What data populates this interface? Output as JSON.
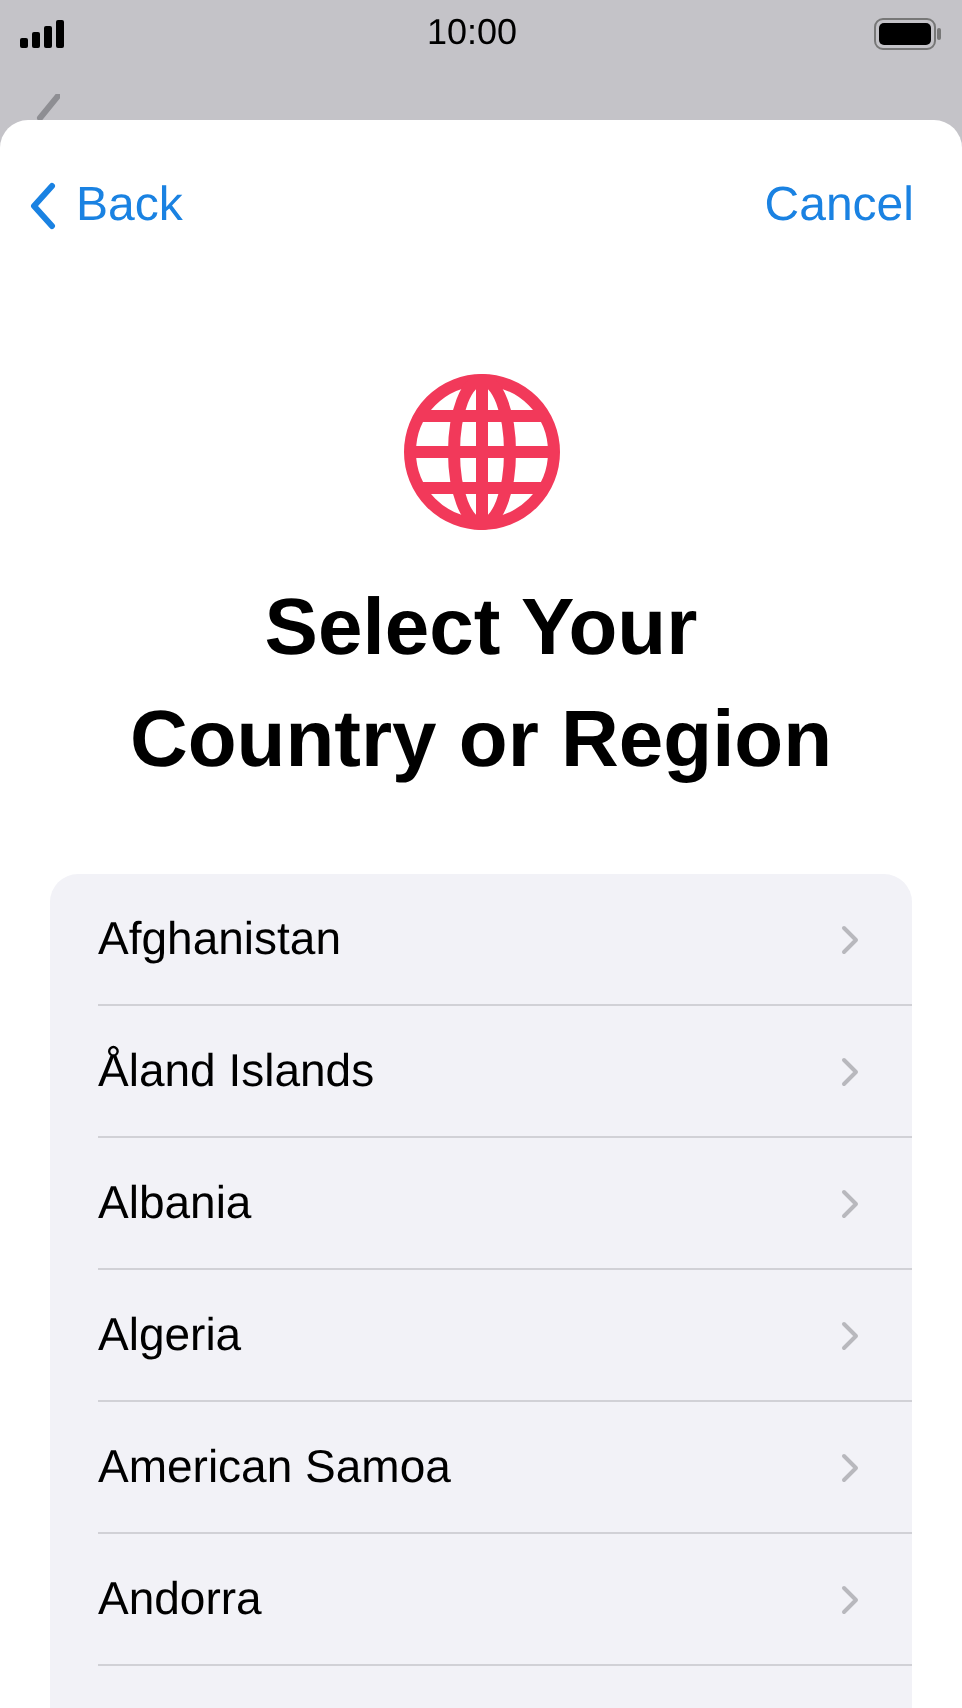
{
  "status_bar": {
    "time": "10:00"
  },
  "nav": {
    "back": "Back",
    "cancel": "Cancel"
  },
  "title": "Select Your Country or Region",
  "countries": [
    {
      "name": "Afghanistan"
    },
    {
      "name": "Åland Islands"
    },
    {
      "name": "Albania"
    },
    {
      "name": "Algeria"
    },
    {
      "name": "American Samoa"
    },
    {
      "name": "Andorra"
    }
  ]
}
